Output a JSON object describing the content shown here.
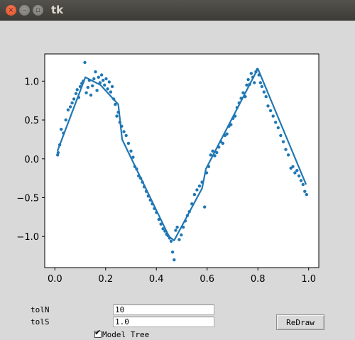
{
  "window": {
    "title": "tk",
    "close_glyph": "×",
    "min_glyph": "–",
    "max_glyph": "▫"
  },
  "controls": {
    "toln_label": "tolN",
    "toln_value": "10",
    "tols_label": "tolS",
    "tols_value": "1.0",
    "model_tree_label": "Model Tree",
    "model_tree_checked": true,
    "check_glyph": "✔",
    "redraw_label": "ReDraw"
  },
  "chart_data": {
    "type": "scatter",
    "xlim": [
      -0.04,
      1.04
    ],
    "ylim": [
      -1.4,
      1.35
    ],
    "x_ticks": [
      0.0,
      0.2,
      0.4,
      0.6,
      0.8,
      1.0
    ],
    "x_tick_labels": [
      "0.0",
      "0.2",
      "0.4",
      "0.6",
      "0.8",
      "1.0"
    ],
    "y_ticks": [
      -1.0,
      -0.5,
      0.0,
      0.5,
      1.0
    ],
    "y_tick_labels": [
      "−1.0",
      "−0.5",
      "0.0",
      "0.5",
      "1.0"
    ],
    "color": "#1f77b4",
    "grid": false,
    "scatter_points": [
      [
        0.011,
        0.05
      ],
      [
        0.013,
        0.08
      ],
      [
        0.019,
        0.18
      ],
      [
        0.025,
        0.38
      ],
      [
        0.034,
        0.33
      ],
      [
        0.043,
        0.5
      ],
      [
        0.052,
        0.63
      ],
      [
        0.061,
        0.67
      ],
      [
        0.068,
        0.72
      ],
      [
        0.075,
        0.77
      ],
      [
        0.083,
        0.84
      ],
      [
        0.088,
        0.89
      ],
      [
        0.094,
        0.79
      ],
      [
        0.1,
        0.93
      ],
      [
        0.106,
        0.97
      ],
      [
        0.112,
        1.0
      ],
      [
        0.118,
        1.24
      ],
      [
        0.124,
        0.85
      ],
      [
        0.13,
        0.92
      ],
      [
        0.136,
        1.01
      ],
      [
        0.142,
        0.82
      ],
      [
        0.148,
        0.94
      ],
      [
        0.154,
        1.03
      ],
      [
        0.16,
        1.12
      ],
      [
        0.166,
        0.88
      ],
      [
        0.172,
        1.05
      ],
      [
        0.178,
        0.98
      ],
      [
        0.184,
        1.08
      ],
      [
        0.19,
        1.01
      ],
      [
        0.196,
        0.95
      ],
      [
        0.202,
        1.03
      ],
      [
        0.208,
        0.9
      ],
      [
        0.214,
        0.99
      ],
      [
        0.22,
        0.86
      ],
      [
        0.226,
        0.93
      ],
      [
        0.232,
        0.77
      ],
      [
        0.238,
        0.7
      ],
      [
        0.244,
        0.55
      ],
      [
        0.25,
        0.6
      ],
      [
        0.256,
        0.47
      ],
      [
        0.263,
        0.42
      ],
      [
        0.272,
        0.35
      ],
      [
        0.281,
        0.3
      ],
      [
        0.29,
        0.2
      ],
      [
        0.3,
        0.1
      ],
      [
        0.308,
        0.02
      ],
      [
        0.315,
        -0.1
      ],
      [
        0.322,
        -0.13
      ],
      [
        0.33,
        -0.22
      ],
      [
        0.338,
        -0.25
      ],
      [
        0.345,
        -0.3
      ],
      [
        0.352,
        -0.36
      ],
      [
        0.36,
        -0.42
      ],
      [
        0.368,
        -0.48
      ],
      [
        0.376,
        -0.53
      ],
      [
        0.384,
        -0.58
      ],
      [
        0.392,
        -0.64
      ],
      [
        0.4,
        -0.69
      ],
      [
        0.41,
        -0.78
      ],
      [
        0.418,
        -0.84
      ],
      [
        0.426,
        -0.9
      ],
      [
        0.434,
        -0.93
      ],
      [
        0.44,
        -0.97
      ],
      [
        0.446,
        -0.99
      ],
      [
        0.452,
        -1.02
      ],
      [
        0.458,
        -1.06
      ],
      [
        0.464,
        -1.2
      ],
      [
        0.47,
        -1.3
      ],
      [
        0.476,
        -0.92
      ],
      [
        0.482,
        -0.88
      ],
      [
        0.49,
        -1.04
      ],
      [
        0.498,
        -0.98
      ],
      [
        0.506,
        -0.88
      ],
      [
        0.514,
        -0.8
      ],
      [
        0.522,
        -0.73
      ],
      [
        0.53,
        -0.68
      ],
      [
        0.54,
        -0.58
      ],
      [
        0.55,
        -0.46
      ],
      [
        0.56,
        -0.4
      ],
      [
        0.57,
        -0.35
      ],
      [
        0.58,
        -0.3
      ],
      [
        0.59,
        -0.62
      ],
      [
        0.598,
        -0.18
      ],
      [
        0.606,
        -0.1
      ],
      [
        0.614,
        0.05
      ],
      [
        0.622,
        0.1
      ],
      [
        0.63,
        0.04
      ],
      [
        0.638,
        0.08
      ],
      [
        0.646,
        0.15
      ],
      [
        0.654,
        0.22
      ],
      [
        0.662,
        0.2
      ],
      [
        0.67,
        0.3
      ],
      [
        0.678,
        0.32
      ],
      [
        0.686,
        0.42
      ],
      [
        0.694,
        0.44
      ],
      [
        0.702,
        0.52
      ],
      [
        0.71,
        0.55
      ],
      [
        0.718,
        0.66
      ],
      [
        0.726,
        0.72
      ],
      [
        0.734,
        0.78
      ],
      [
        0.742,
        0.85
      ],
      [
        0.75,
        0.8
      ],
      [
        0.756,
        0.95
      ],
      [
        0.762,
        1.02
      ],
      [
        0.768,
        0.96
      ],
      [
        0.774,
        1.1
      ],
      [
        0.78,
        1.05
      ],
      [
        0.786,
        0.98
      ],
      [
        0.792,
        1.12
      ],
      [
        0.798,
        1.15
      ],
      [
        0.804,
        1.08
      ],
      [
        0.81,
        0.98
      ],
      [
        0.816,
        0.93
      ],
      [
        0.824,
        0.86
      ],
      [
        0.832,
        0.8
      ],
      [
        0.84,
        0.68
      ],
      [
        0.85,
        0.62
      ],
      [
        0.86,
        0.55
      ],
      [
        0.87,
        0.47
      ],
      [
        0.88,
        0.4
      ],
      [
        0.89,
        0.3
      ],
      [
        0.9,
        0.22
      ],
      [
        0.91,
        0.12
      ],
      [
        0.92,
        0.05
      ],
      [
        0.93,
        -0.12
      ],
      [
        0.938,
        -0.1
      ],
      [
        0.946,
        -0.18
      ],
      [
        0.954,
        -0.15
      ],
      [
        0.962,
        -0.22
      ],
      [
        0.97,
        -0.28
      ],
      [
        0.978,
        -0.33
      ],
      [
        0.985,
        -0.42
      ],
      [
        0.992,
        -0.46
      ]
    ],
    "fit_line": [
      [
        0.01,
        0.1
      ],
      [
        0.12,
        1.05
      ],
      [
        0.18,
        0.95
      ],
      [
        0.25,
        0.7
      ],
      [
        0.265,
        0.25
      ],
      [
        0.45,
        -1.0
      ],
      [
        0.47,
        -1.05
      ],
      [
        0.58,
        -0.38
      ],
      [
        0.595,
        -0.13
      ],
      [
        0.8,
        1.16
      ],
      [
        0.99,
        -0.33
      ]
    ]
  }
}
